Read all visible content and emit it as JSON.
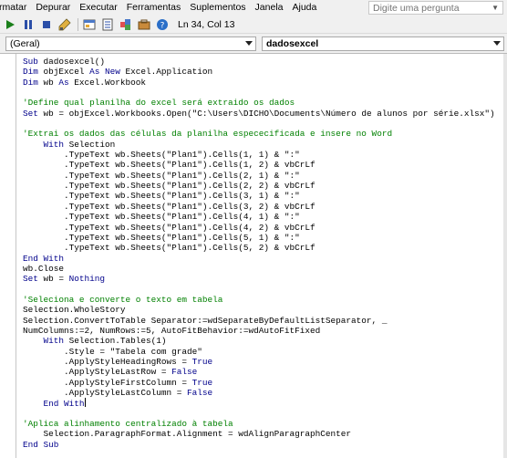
{
  "menubar": {
    "items": [
      "rmatar",
      "Depurar",
      "Executar",
      "Ferramentas",
      "Suplementos",
      "Janela",
      "Ajuda"
    ],
    "help_placeholder": "Digite uma pergunta"
  },
  "toolbar": {
    "cursor_position": "Ln 34, Col 13"
  },
  "combos": {
    "object": "(Geral)",
    "procedure": "dadosexcel"
  },
  "code": {
    "lines": [
      [
        {
          "t": "Sub ",
          "k": "kw"
        },
        {
          "t": "dadosexcel()"
        }
      ],
      [
        {
          "t": "Dim ",
          "k": "kw"
        },
        {
          "t": "objExcel "
        },
        {
          "t": "As New ",
          "k": "kw"
        },
        {
          "t": "Excel.Application"
        }
      ],
      [
        {
          "t": "Dim ",
          "k": "kw"
        },
        {
          "t": "wb "
        },
        {
          "t": "As ",
          "k": "kw"
        },
        {
          "t": "Excel.Workbook"
        }
      ],
      [],
      [
        {
          "t": "'Define qual planilha do excel será extraido os dados",
          "k": "cm"
        }
      ],
      [
        {
          "t": "Set ",
          "k": "kw"
        },
        {
          "t": "wb = objExcel.Workbooks.Open(\"C:\\Users\\DICHO\\Documents\\Número de alunos por série.xlsx\")"
        }
      ],
      [],
      [
        {
          "t": "'Extrai os dados das células da planilha espececificada e insere no Word",
          "k": "cm"
        }
      ],
      [
        {
          "t": "    "
        },
        {
          "t": "With ",
          "k": "kw"
        },
        {
          "t": "Selection"
        }
      ],
      [
        {
          "t": "        .TypeText wb.Sheets(\"Plan1\").Cells(1, 1) & \":\""
        }
      ],
      [
        {
          "t": "        .TypeText wb.Sheets(\"Plan1\").Cells(1, 2) & vbCrLf"
        }
      ],
      [
        {
          "t": "        .TypeText wb.Sheets(\"Plan1\").Cells(2, 1) & \":\""
        }
      ],
      [
        {
          "t": "        .TypeText wb.Sheets(\"Plan1\").Cells(2, 2) & vbCrLf"
        }
      ],
      [
        {
          "t": "        .TypeText wb.Sheets(\"Plan1\").Cells(3, 1) & \":\""
        }
      ],
      [
        {
          "t": "        .TypeText wb.Sheets(\"Plan1\").Cells(3, 2) & vbCrLf"
        }
      ],
      [
        {
          "t": "        .TypeText wb.Sheets(\"Plan1\").Cells(4, 1) & \":\""
        }
      ],
      [
        {
          "t": "        .TypeText wb.Sheets(\"Plan1\").Cells(4, 2) & vbCrLf"
        }
      ],
      [
        {
          "t": "        .TypeText wb.Sheets(\"Plan1\").Cells(5, 1) & \":\""
        }
      ],
      [
        {
          "t": "        .TypeText wb.Sheets(\"Plan1\").Cells(5, 2) & vbCrLf"
        }
      ],
      [
        {
          "t": "End With",
          "k": "kw"
        }
      ],
      [
        {
          "t": "wb.Close"
        }
      ],
      [
        {
          "t": "Set ",
          "k": "kw"
        },
        {
          "t": "wb = "
        },
        {
          "t": "Nothing",
          "k": "kw"
        }
      ],
      [],
      [
        {
          "t": "'Seleciona e converte o texto em tabela",
          "k": "cm"
        }
      ],
      [
        {
          "t": "Selection.WholeStory"
        }
      ],
      [
        {
          "t": "Selection.ConvertToTable Separator:=wdSeparateByDefaultListSeparator, _"
        }
      ],
      [
        {
          "t": "NumColumns:=2, NumRows:=5, AutoFitBehavior:=wdAutoFitFixed"
        }
      ],
      [
        {
          "t": "    "
        },
        {
          "t": "With ",
          "k": "kw"
        },
        {
          "t": "Selection.Tables(1)"
        }
      ],
      [
        {
          "t": "        .Style = \"Tabela com grade\""
        }
      ],
      [
        {
          "t": "        .ApplyStyleHeadingRows = "
        },
        {
          "t": "True",
          "k": "kw"
        }
      ],
      [
        {
          "t": "        .ApplyStyleLastRow = "
        },
        {
          "t": "False",
          "k": "kw"
        }
      ],
      [
        {
          "t": "        .ApplyStyleFirstColumn = "
        },
        {
          "t": "True",
          "k": "kw"
        }
      ],
      [
        {
          "t": "        .ApplyStyleLastColumn = "
        },
        {
          "t": "False",
          "k": "kw"
        }
      ],
      [
        {
          "t": "    "
        },
        {
          "t": "End With",
          "k": "kw"
        },
        {
          "t": "",
          "caret": true
        }
      ],
      [],
      [
        {
          "t": "'Aplica alinhamento centralizado à tabela",
          "k": "cm"
        }
      ],
      [
        {
          "t": "    Selection.ParagraphFormat.Alignment = wdAlignParagraphCenter"
        }
      ],
      [
        {
          "t": "End Sub",
          "k": "kw"
        }
      ]
    ]
  },
  "colors": {
    "keyword": "#00008b",
    "comment": "#008000",
    "chrome": "#f0f0f0"
  },
  "icons": [
    "run-icon",
    "pause-icon",
    "stop-icon",
    "design-mode-icon",
    "project-explorer-icon",
    "properties-icon",
    "object-browser-icon",
    "toolbox-icon",
    "help-icon"
  ]
}
